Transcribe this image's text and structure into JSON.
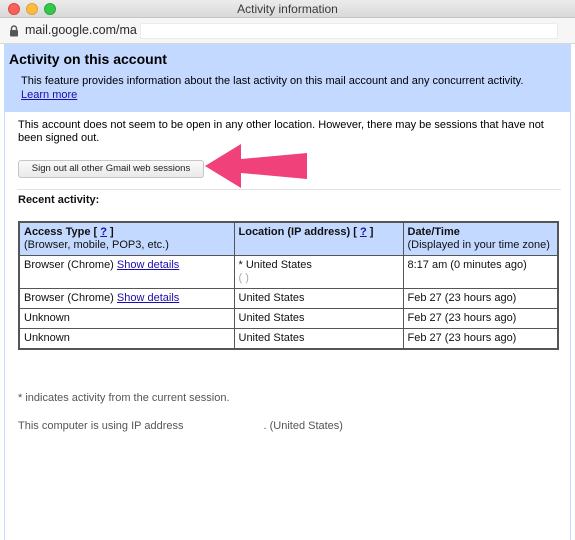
{
  "window": {
    "title": "Activity information"
  },
  "browser": {
    "url": "mail.google.com/mail"
  },
  "header": {
    "title": "Activity on this account",
    "description": "This feature provides information about the last activity on this mail account and any concurrent activity.",
    "learn_more": "Learn more"
  },
  "notice": "This account does not seem to be open in any other location. However, there may be sessions that have not been signed out.",
  "signout_button": "Sign out all other Gmail web sessions",
  "recent": {
    "title": "Recent activity:",
    "headers": {
      "access_type": "Access Type",
      "access_type_help": "?",
      "access_type_sub": "(Browser, mobile, POP3, etc.)",
      "location": "Location (IP address)",
      "location_help": "?",
      "datetime": "Date/Time",
      "datetime_sub": "(Displayed in your time zone)"
    },
    "rows": [
      {
        "access": "Browser (Chrome)",
        "details": "Show details",
        "location": "* United States",
        "ip": "(                              )",
        "time": "8:17 am (0 minutes ago)"
      },
      {
        "access": "Browser (Chrome)",
        "details": "Show details",
        "location": "United States",
        "time": "Feb 27 (23 hours ago)"
      },
      {
        "access": "Unknown",
        "location": "United States",
        "time": "Feb 27 (23 hours ago)"
      },
      {
        "access": "Unknown",
        "location": "United States",
        "time": "Feb 27 (23 hours ago)"
      }
    ]
  },
  "footnote": "* indicates activity from the current session.",
  "ip_note": {
    "prefix": "This computer is using IP address",
    "suffix": ". (United States)"
  },
  "colors": {
    "header_bg": "#c3d9ff",
    "link": "#1a0dab",
    "arrow": "#f0417a"
  }
}
